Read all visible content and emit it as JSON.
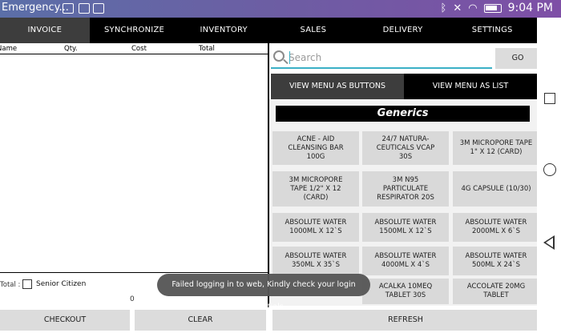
{
  "status_bar": {
    "app_title": "Emergency...",
    "time": "9:04 PM"
  },
  "tabs": [
    {
      "label": "INVOICE",
      "active": true
    },
    {
      "label": "SYNCHRONIZE",
      "active": false
    },
    {
      "label": "INVENTORY",
      "active": false
    },
    {
      "label": "SALES",
      "active": false
    },
    {
      "label": "DELIVERY",
      "active": false
    },
    {
      "label": "SETTINGS",
      "active": false
    }
  ],
  "invoice": {
    "columns": [
      "Name",
      "Qty.",
      "Cost",
      "Total"
    ],
    "total_label": "Total :",
    "senior_citizen_label": "Senior Citizen",
    "total_value": "0",
    "checkout_label": "CHECKOUT",
    "clear_label": "CLEAR"
  },
  "search": {
    "placeholder": "Search",
    "go_label": "GO"
  },
  "view_toggle": {
    "buttons_label": "VIEW MENU AS BUTTONS",
    "list_label": "VIEW MENU AS LIST"
  },
  "menu": {
    "category": "Generics",
    "products": [
      "ACNE - AID\nCLEANSING BAR\n100G",
      "24/7 NATURA-\nCEUTICALS VCAP\n30S",
      "3M MICROPORE TAPE\n1\" X 12 (CARD)",
      "3M MICROPORE\nTAPE 1/2\" X 12\n(CARD)",
      "3M N95\nPARTICULATE\nRESPIRATOR 20S",
      "4G CAPSULE (10/30)",
      "ABSOLUTE WATER\n1000ML X 12`S",
      "ABSOLUTE WATER\n1500ML X 12`S",
      "ABSOLUTE WATER\n2000ML X 6`S",
      "ABSOLUTE WATER\n350ML X 35`S",
      "ABSOLUTE WATER\n4000ML X 4`S",
      "ABSOLUTE WATER\n500ML X 24`S",
      "ACALKA 10MEQ\nTABLET 30S",
      "ACCOLATE 20MG\nTABLET"
    ],
    "refresh_label": "REFRESH"
  },
  "toast": {
    "message": "Failed logging in to web, Kindly check your login credentials."
  },
  "colors": {
    "accent": "#3bb0c6",
    "tab_active": "#3d3d3d",
    "status_bar": "#6d5da3"
  }
}
